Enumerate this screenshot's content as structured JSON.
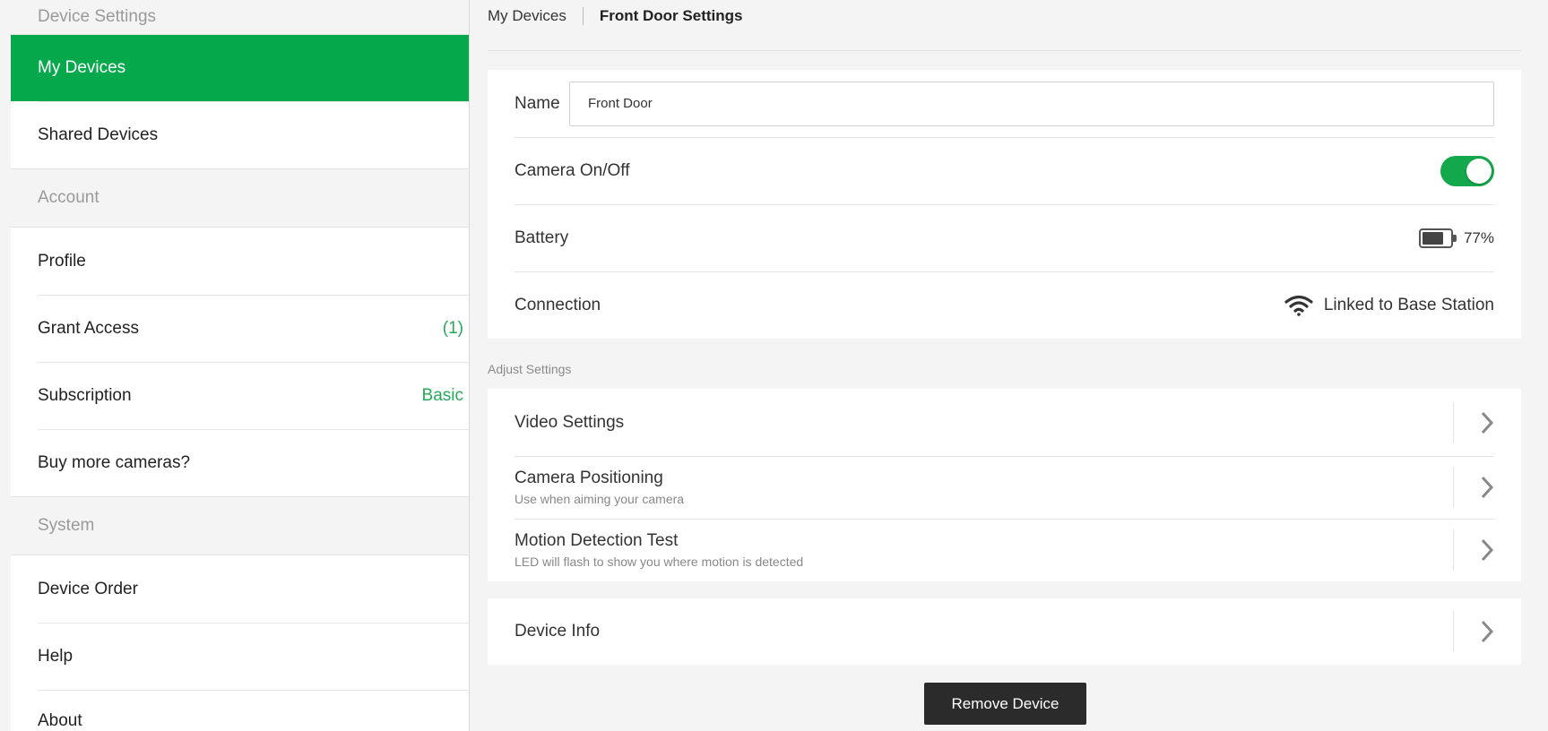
{
  "sidebar": {
    "sections": {
      "device_settings": "Device Settings",
      "account": "Account",
      "system": "System"
    },
    "items": {
      "my_devices": "My Devices",
      "shared_devices": "Shared Devices",
      "profile": "Profile",
      "grant_access": "Grant Access",
      "grant_access_count": "(1)",
      "subscription": "Subscription",
      "subscription_value": "Basic",
      "buy_more": "Buy more cameras?",
      "device_order": "Device Order",
      "help": "Help",
      "about": "About"
    },
    "active_color": "#05a94b"
  },
  "breadcrumb": {
    "parent": "My Devices",
    "current": "Front Door Settings"
  },
  "device": {
    "name_label": "Name",
    "name_value": "Front Door",
    "camera_label": "Camera On/Off",
    "camera_on": true,
    "battery_label": "Battery",
    "battery_text": "77%",
    "battery_level": 0.77,
    "connection_label": "Connection",
    "connection_value": "Linked to Base Station"
  },
  "adjust": {
    "caption": "Adjust Settings",
    "video_settings": "Video Settings",
    "camera_positioning": "Camera Positioning",
    "camera_positioning_sub": "Use when aiming your camera",
    "motion_test": "Motion Detection Test",
    "motion_test_sub": "LED will flash to show you where motion is detected"
  },
  "device_info": "Device Info",
  "remove_button": "Remove Device",
  "icons": {
    "battery": "battery-icon",
    "wifi": "wifi-icon",
    "chevron": "chevron-right-icon"
  }
}
